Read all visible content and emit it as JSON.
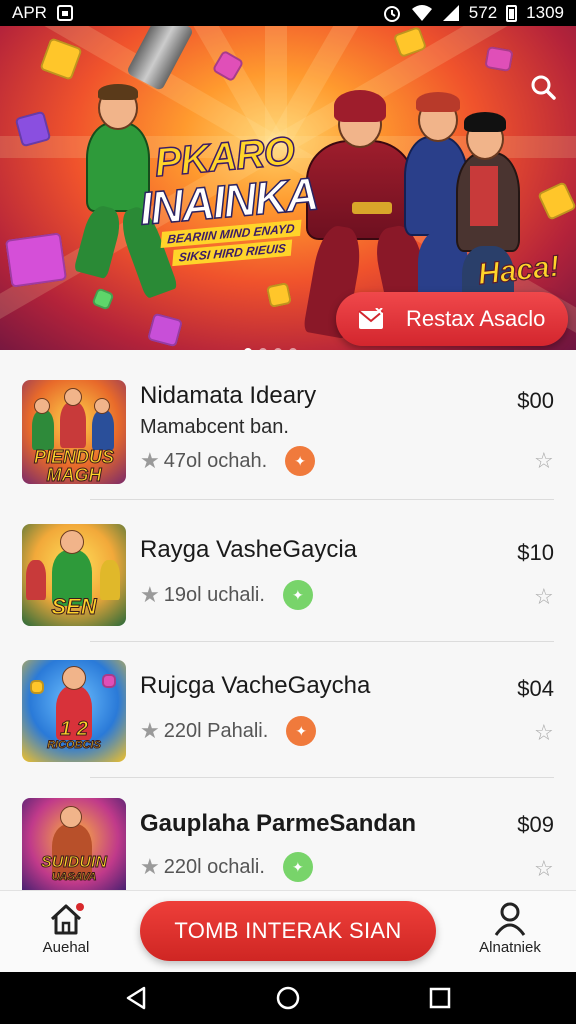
{
  "status_bar": {
    "left_text": "APR",
    "battery_level": "572",
    "time": "1309"
  },
  "hero": {
    "title_line1": "PKARO",
    "title_line2": "INAINKA",
    "tagline_line1": "BEARIIN MIND ENAYD",
    "tagline_line2": "SIKSI HIRD RIEUIS",
    "corner_text": "Haca!",
    "cta_label": "Restax Asaclo",
    "carousel_dots": 4,
    "active_dot": 0
  },
  "games": [
    {
      "title": "Nidamata Ideary",
      "subtitle": "Mamabcent ban.",
      "meta": "47ol ochah.",
      "price": "$00",
      "badge_color": "orange",
      "thumb_label_1": "PIENDUS",
      "thumb_label_2": "MAGH"
    },
    {
      "title": "Rayga VasheGaycia",
      "subtitle": "",
      "meta": "19ol uchali.",
      "price": "$10",
      "badge_color": "green",
      "thumb_label_1": "SEN",
      "thumb_label_2": ""
    },
    {
      "title": "Rujcga VacheGaycha",
      "subtitle": "",
      "meta": "220l Pahali.",
      "price": "$04",
      "badge_color": "orange",
      "thumb_label_1": "1 2",
      "thumb_label_2": "RICOBCIS"
    },
    {
      "title": "Gauplaha ParmeSandan",
      "subtitle": "",
      "meta": "220l ochali.",
      "price": "$09",
      "badge_color": "green",
      "thumb_label_1": "SUIDUIN",
      "thumb_label_2": "UASAVA"
    }
  ],
  "bottom_nav": {
    "home_label": "Auehal",
    "main_cta": "TOMB INTERAK SIAN",
    "profile_label": "Alnatniek"
  },
  "colors": {
    "accent_red": "#d8292c",
    "badge_orange": "#f07a3c",
    "badge_green": "#78d46a"
  }
}
